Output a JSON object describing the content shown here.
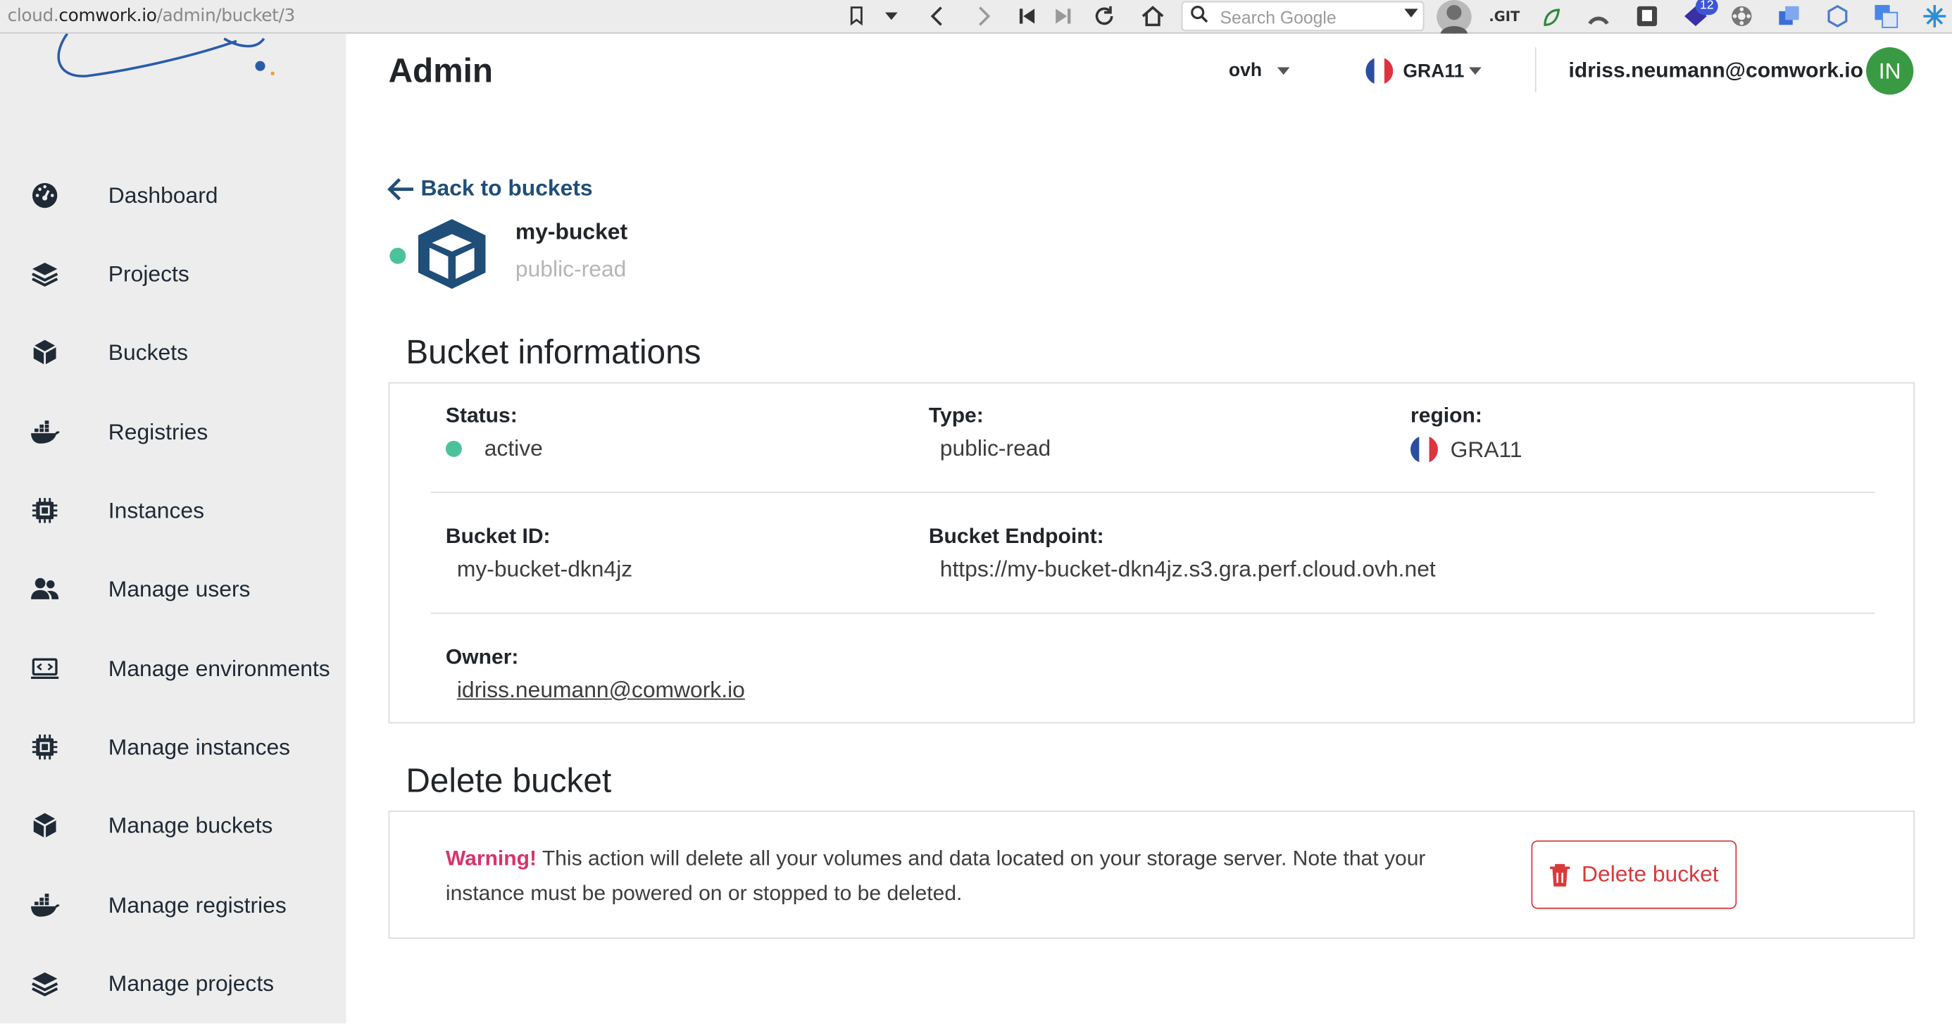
{
  "browser": {
    "url_prefix": "cloud.",
    "url_domain": "comwork.io",
    "url_path": "/admin/bucket/3",
    "search_placeholder": "Search Google",
    "ext_git_label": ".GIT",
    "ext_badge_count": "12"
  },
  "header": {
    "title": "Admin",
    "provider": "ovh",
    "region": "GRA11",
    "user_email": "idriss.neumann@comwork.io",
    "avatar_initials": "IN"
  },
  "sidebar": {
    "items": [
      {
        "label": "Dashboard",
        "icon": "dashboard-icon"
      },
      {
        "label": "Projects",
        "icon": "layers-icon"
      },
      {
        "label": "Buckets",
        "icon": "cube-icon"
      },
      {
        "label": "Registries",
        "icon": "docker-icon"
      },
      {
        "label": "Instances",
        "icon": "chip-icon"
      },
      {
        "label": "Manage users",
        "icon": "users-icon"
      },
      {
        "label": "Manage environments",
        "icon": "laptop-code-icon"
      },
      {
        "label": "Manage instances",
        "icon": "chip-icon"
      },
      {
        "label": "Manage buckets",
        "icon": "cube-icon"
      },
      {
        "label": "Manage registries",
        "icon": "docker-icon"
      },
      {
        "label": "Manage projects",
        "icon": "layers-icon"
      }
    ]
  },
  "back_link": "Back to buckets",
  "bucket": {
    "name": "my-bucket",
    "acl": "public-read"
  },
  "info_section": {
    "title": "Bucket informations",
    "status_label": "Status:",
    "status_value": "active",
    "type_label": "Type:",
    "type_value": "public-read",
    "region_label": "region:",
    "region_value": "GRA11",
    "bucket_id_label": "Bucket ID:",
    "bucket_id_value": "my-bucket-dkn4jz",
    "endpoint_label": "Bucket Endpoint:",
    "endpoint_value": "https://my-bucket-dkn4jz.s3.gra.perf.cloud.ovh.net",
    "owner_label": "Owner:",
    "owner_value": "idriss.neumann@comwork.io"
  },
  "delete_section": {
    "title": "Delete bucket",
    "warning_strong": "Warning!",
    "warning_text": " This action will delete all your volumes and data located on your storage server. Note that your instance must be powered on or stopped to be deleted.",
    "button_label": "Delete bucket"
  },
  "colors": {
    "accent": "#1f4e79",
    "status_active": "#4cc29a",
    "danger": "#d83a3a",
    "warning": "#d9336b",
    "avatar_bg": "#3a9a44"
  }
}
